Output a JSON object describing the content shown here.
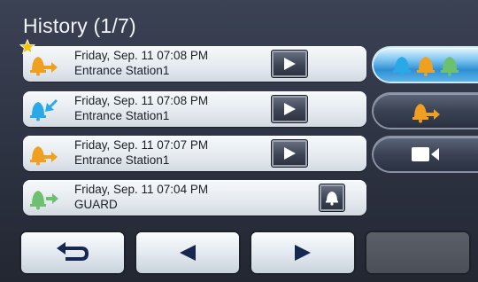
{
  "header": {
    "title": "History (1/7)"
  },
  "history": [
    {
      "date": "Friday, Sep. 11 07:08 PM",
      "source": "Entrance Station1",
      "type": "door-call",
      "starred": true,
      "action": "play"
    },
    {
      "date": "Friday, Sep. 11 07:08 PM",
      "source": "Entrance Station1",
      "type": "incoming-call",
      "starred": false,
      "action": "play"
    },
    {
      "date": "Friday, Sep. 11 07:07 PM",
      "source": "Entrance Station1",
      "type": "door-call",
      "starred": false,
      "action": "play"
    },
    {
      "date": "Friday, Sep. 11 07:04 PM",
      "source": "GUARD",
      "type": "guard-call",
      "starred": false,
      "action": "bell"
    }
  ],
  "filters": [
    {
      "name": "all-calls",
      "icon": "three-bells-icon",
      "active": true
    },
    {
      "name": "door-calls",
      "icon": "door-bell-icon",
      "active": false
    },
    {
      "name": "video",
      "icon": "video-camera-icon",
      "active": false
    }
  ],
  "footer": {
    "buttons": [
      {
        "name": "back",
        "icon": "return-arrow-icon"
      },
      {
        "name": "previous",
        "icon": "triangle-left-icon"
      },
      {
        "name": "next",
        "icon": "triangle-right-icon"
      },
      {
        "name": "blank",
        "icon": ""
      }
    ]
  },
  "colors": {
    "orange": "#f0a020",
    "blue": "#2aa8e8",
    "green": "#6cc070",
    "star": "#f5c400"
  }
}
